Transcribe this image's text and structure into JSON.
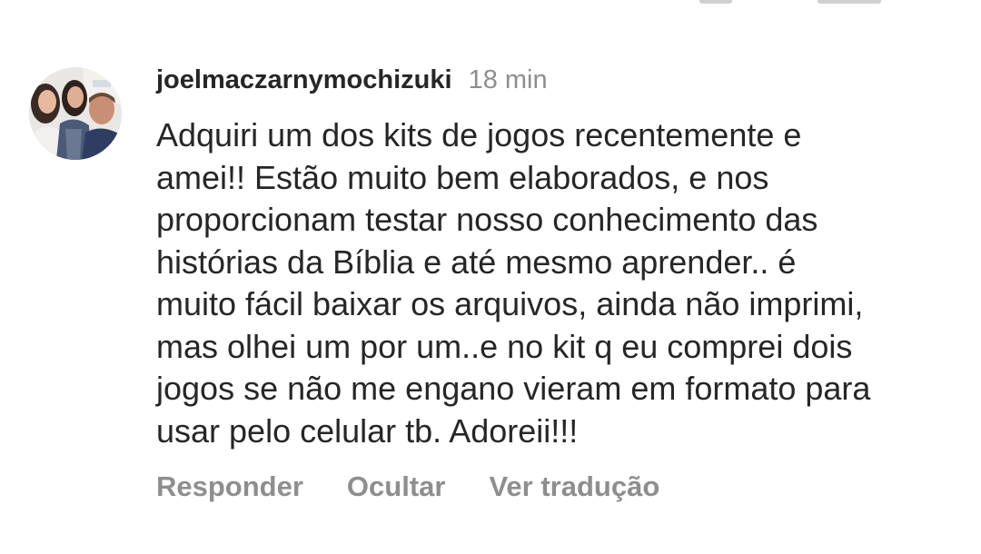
{
  "comment": {
    "avatar_icon": "profile-photo-avatar",
    "username": "joelmaczarnymochizuki",
    "time": "18 min",
    "text": "Adquiri um dos kits de jogos recentemente e\namei!! Estão muito bem elaborados, e nos\nproporcionam testar nosso conhecimento das\nhistórias da Bíblia e até mesmo aprender.. é\nmuito fácil baixar os arquivos, ainda não imprimi,\nmas olhei um por um..e no kit q eu comprei dois\njogos se não me engano vieram em formato para\nusar pelo celular tb. Adoreii!!!",
    "actions": {
      "reply": "Responder",
      "hide": "Ocultar",
      "translate": "Ver tradução"
    }
  },
  "colors": {
    "text": "#262626",
    "secondary": "#8e8e8e",
    "background": "#ffffff"
  }
}
